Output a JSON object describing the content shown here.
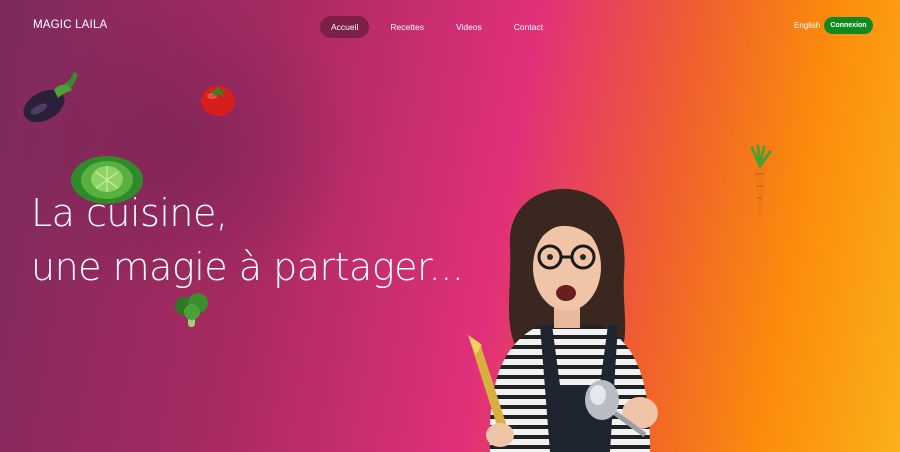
{
  "brand": "MAGIC LAILA",
  "nav": {
    "items": [
      {
        "label": "Accueil",
        "active": true
      },
      {
        "label": "Recettes",
        "active": false
      },
      {
        "label": "Videos",
        "active": false
      },
      {
        "label": "Contact",
        "active": false
      }
    ],
    "language": "English",
    "login": "Connexion"
  },
  "hero": {
    "line1": "La cuisine,",
    "line2": "une magie à partager..."
  },
  "colors": {
    "accent_active": "#7c2048",
    "login_button": "#0e8a1e",
    "gradient": [
      "#7c2a5b",
      "#e0307a",
      "#fb8a0c",
      "#fbb018"
    ]
  },
  "images": [
    "eggplant-icon",
    "tomato-icon",
    "cabbage-icon",
    "broccoli-icon",
    "carrot-icon",
    "chef-photo"
  ]
}
